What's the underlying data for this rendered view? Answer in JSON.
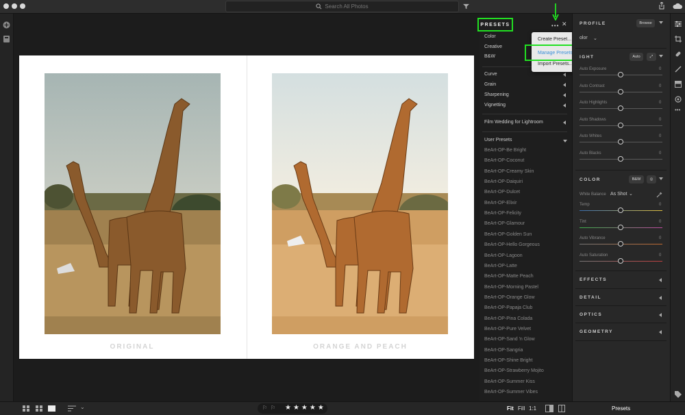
{
  "search": {
    "placeholder": "Search All Photos"
  },
  "photo": {
    "left_caption": "ORIGINAL",
    "right_caption": "ORANGE AND PEACH"
  },
  "presets": {
    "title": "PRESETS",
    "groups": [
      "Color",
      "Creative",
      "B&W"
    ],
    "effects": [
      "Curve",
      "Grain",
      "Sharpening",
      "Vignetting"
    ],
    "film_group": "Film Wedding for Lightroom",
    "user_group": "User Presets",
    "user_items": [
      "BeArt-OP-Be Bright",
      "BeArt-OP-Coconut",
      "BeArt-OP-Creamy Skin",
      "BeArt-OP-Daiquiri",
      "BeArt-OP-Dulcet",
      "BeArt-OP-Elixir",
      "BeArt-OP-Felicity",
      "BeArt-OP-Glamour",
      "BeArt-OP-Golden Sun",
      "BeArt-OP-Hello Gorgeous",
      "BeArt-OP-Lagoon",
      "BeArt-OP-Latte",
      "BeArt-OP-Matte Peach",
      "BeArt-OP-Morning Pastel",
      "BeArt-OP-Orange Glow",
      "BeArt-OP-Papaja Club",
      "BeArt-OP-Pina Colada",
      "BeArt-OP-Pure Velvet",
      "BeArt-OP-Sand 'n Glow",
      "BeArt-OP-Sangria",
      "BeArt-OP-Shine Bright",
      "BeArt-OP-Strawberry Mojito",
      "BeArt-OP-Summer Kiss",
      "BeArt-OP-Summer Vibes"
    ]
  },
  "menu": {
    "create": "Create Preset...",
    "manage": "Manage Presets",
    "import": "Import Presets..."
  },
  "right": {
    "profile": "PROFILE",
    "browse": "Browse",
    "profile_value": "olor",
    "light": "IGHT",
    "auto": "Auto",
    "light_sliders": [
      {
        "label": "Auto Exposure",
        "value": "0"
      },
      {
        "label": "Auto Contrast",
        "value": "0"
      },
      {
        "label": "Auto Highlights",
        "value": "0"
      },
      {
        "label": "Auto Shadows",
        "value": "0"
      },
      {
        "label": "Auto Whites",
        "value": "0"
      },
      {
        "label": "Auto Blacks",
        "value": "0"
      }
    ],
    "color": "COLOR",
    "bw": "B&W",
    "wb_label": "White Balance",
    "wb_value": "As Shot",
    "color_sliders": [
      {
        "label": "Temp",
        "value": "0"
      },
      {
        "label": "Tint",
        "value": "0"
      },
      {
        "label": "Auto Vibrance",
        "value": "0"
      },
      {
        "label": "Auto Saturation",
        "value": "0"
      }
    ],
    "effects": "EFFECTS",
    "detail": "DETAIL",
    "optics": "OPTICS",
    "geometry": "GEOMETRY"
  },
  "bottom": {
    "fit": "Fit",
    "fill": "Fill",
    "one": "1:1",
    "presets": "Presets"
  },
  "colors": {
    "highlight": "#22e022",
    "arrow": "#22e022",
    "accent": "#3a8fd8"
  }
}
